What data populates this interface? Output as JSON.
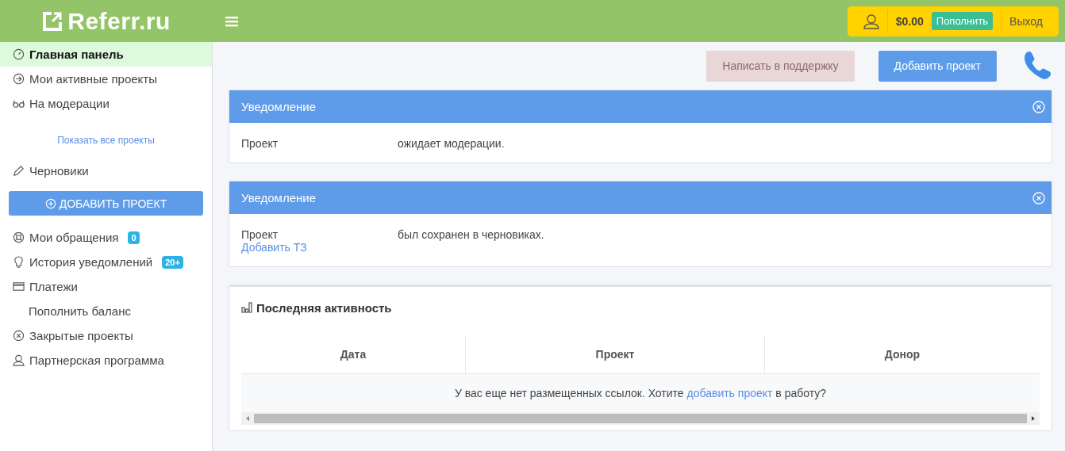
{
  "header": {
    "logo": "Referr.ru",
    "balance": "$0.00",
    "topup_button": "Пополнить",
    "logout": "Выход"
  },
  "sidebar": {
    "items": [
      {
        "kind": "nav",
        "label": "Главная панель",
        "selected": true
      },
      {
        "kind": "nav",
        "label": "Мои активные проекты",
        "selected": false
      },
      {
        "kind": "nav",
        "label": "На модерации",
        "selected": false
      },
      {
        "kind": "center-link",
        "label": "Показать все проекты",
        "selected": false
      },
      {
        "kind": "nav",
        "label": "Черновики",
        "selected": false
      },
      {
        "kind": "button",
        "label": "ДОБАВИТЬ ПРОЕКТ",
        "selected": false
      },
      {
        "kind": "nav",
        "label": "Мои обращения",
        "badge": "0",
        "selected": false
      },
      {
        "kind": "nav",
        "label": "История уведомлений",
        "badge": "20+",
        "selected": false
      },
      {
        "kind": "nav",
        "label": "Платежи",
        "selected": false
      },
      {
        "kind": "sub",
        "label": "Пополнить баланс",
        "selected": false
      },
      {
        "kind": "nav",
        "label": "Закрытые проекты",
        "selected": false
      },
      {
        "kind": "nav",
        "label": "Партнерская программа",
        "selected": false
      }
    ]
  },
  "toolbar": {
    "support_button": "Написать в поддержку",
    "support_disabled": true,
    "add_button": "Добавить проект"
  },
  "notifications": [
    {
      "title": "Уведомление",
      "label": "Проект",
      "text": "ожидает модерации."
    },
    {
      "title": "Уведомление",
      "label": "Проект",
      "text": "был сохранен в черновиках.",
      "link": "Добавить ТЗ"
    }
  ],
  "activity": {
    "title": "Последняя активность",
    "columns": [
      "Дата",
      "Проект",
      "Донор"
    ],
    "empty_message": {
      "before": "У вас еще нет размещенных ссылок. Хотите",
      "link": "добавить проект",
      "after": "в работу?"
    }
  }
}
